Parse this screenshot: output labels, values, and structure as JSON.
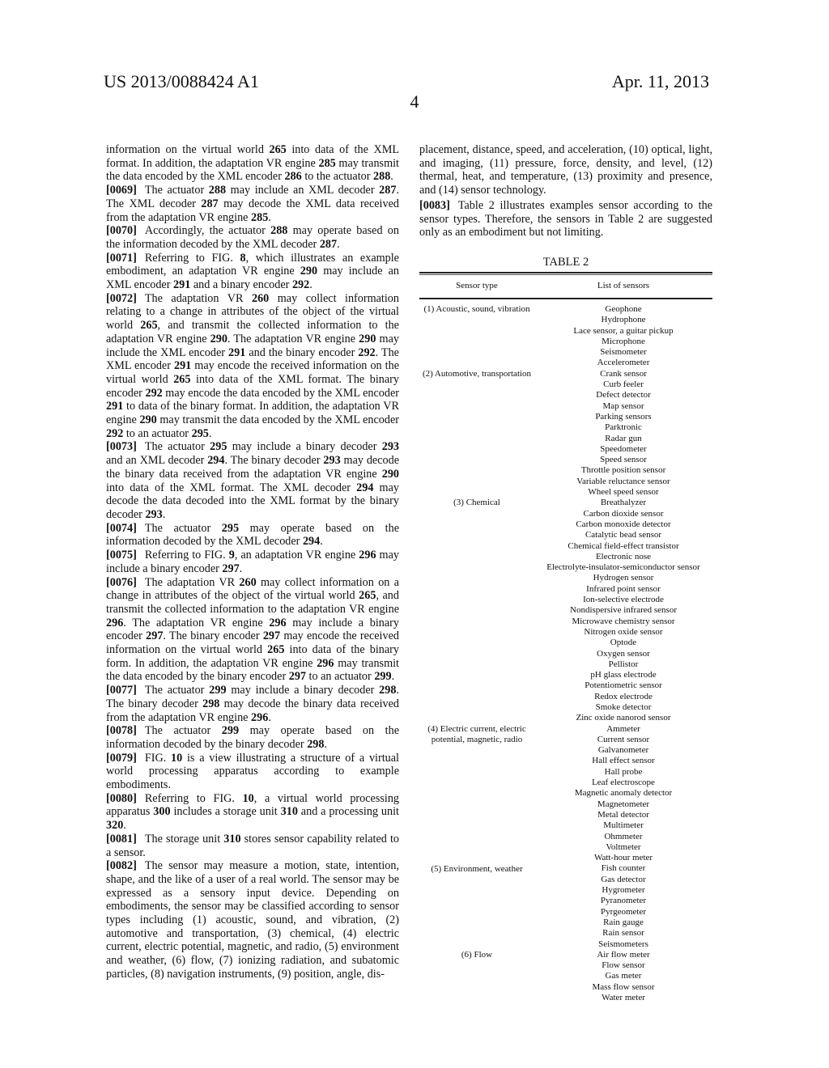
{
  "header": {
    "publication_number": "US 2013/0088424 A1",
    "date": "Apr. 11, 2013",
    "page_number": "4"
  },
  "left_column": [
    {
      "num": "",
      "html": "information on the virtual world <b>265</b> into data of the XML format. In addition, the adaptation VR engine <b>285</b> may transmit the data encoded by the XML encoder <b>286</b> to the actuator <b>288</b>."
    },
    {
      "num": "[0069]",
      "html": "The actuator <b>288</b> may include an XML decoder <b>287</b>. The XML decoder <b>287</b> may decode the XML data received from the adaptation VR engine <b>285</b>."
    },
    {
      "num": "[0070]",
      "html": "Accordingly, the actuator <b>288</b> may operate based on the information decoded by the XML decoder <b>287</b>."
    },
    {
      "num": "[0071]",
      "html": "Referring to FIG. <b>8</b>, which illustrates an example embodiment, an adaptation VR engine <b>290</b> may include an XML encoder <b>291</b> and a binary encoder <b>292</b>."
    },
    {
      "num": "[0072]",
      "html": "The adaptation VR <b>260</b> may collect information relating to a change in attributes of the object of the virtual world <b>265</b>, and transmit the collected information to the adaptation VR engine <b>290</b>. The adaptation VR engine <b>290</b> may include the XML encoder <b>291</b> and the binary encoder <b>292</b>. The XML encoder <b>291</b> may encode the received information on the virtual world <b>265</b> into data of the XML format. The binary encoder <b>292</b> may encode the data encoded by the XML encoder <b>291</b> to data of the binary format. In addition, the adaptation VR engine <b>290</b> may transmit the data encoded by the XML encoder <b>292</b> to an actuator <b>295</b>."
    },
    {
      "num": "[0073]",
      "html": "The actuator <b>295</b> may include a binary decoder <b>293</b> and an XML decoder <b>294</b>. The binary decoder <b>293</b> may decode the binary data received from the adaptation VR engine <b>290</b> into data of the XML format. The XML decoder <b>294</b> may decode the data decoded into the XML format by the binary decoder <b>293</b>."
    },
    {
      "num": "[0074]",
      "html": "The actuator <b>295</b> may operate based on the information decoded by the XML decoder <b>294</b>."
    },
    {
      "num": "[0075]",
      "html": "Referring to FIG. <b>9</b>, an adaptation VR engine <b>296</b> may include a binary encoder <b>297</b>."
    },
    {
      "num": "[0076]",
      "html": "The adaptation VR <b>260</b> may collect information on a change in attributes of the object of the virtual world <b>265</b>, and transmit the collected information to the adaptation VR engine <b>296</b>. The adaptation VR engine <b>296</b> may include a binary encoder <b>297</b>. The binary encoder <b>297</b> may encode the received information on the virtual world <b>265</b> into data of the binary form. In addition, the adaptation VR engine <b>296</b> may transmit the data encoded by the binary encoder <b>297</b> to an actuator <b>299</b>."
    },
    {
      "num": "[0077]",
      "html": "The actuator <b>299</b> may include a binary decoder <b>298</b>. The binary decoder <b>298</b> may decode the binary data received from the adaptation VR engine <b>296</b>."
    },
    {
      "num": "[0078]",
      "html": "The actuator <b>299</b> may operate based on the information decoded by the binary decoder <b>298</b>."
    },
    {
      "num": "[0079]",
      "html": "FIG. <b>10</b> is a view illustrating a structure of a virtual world processing apparatus according to example embodiments."
    },
    {
      "num": "[0080]",
      "html": "Referring to FIG. <b>10</b>, a virtual world processing apparatus <b>300</b> includes a storage unit <b>310</b> and a processing unit <b>320</b>."
    },
    {
      "num": "[0081]",
      "html": "The storage unit <b>310</b> stores sensor capability related to a sensor."
    },
    {
      "num": "[0082]",
      "html": "The sensor may measure a motion, state, intention, shape, and the like of a user of a real world. The sensor may be expressed as a sensory input device. Depending on embodiments, the sensor may be classified according to sensor types including (1) acoustic, sound, and vibration, (2) automotive and transportation, (3) chemical, (4) electric current, electric potential, magnetic, and radio, (5) environment and weather, (6) flow, (7) ionizing radiation, and subatomic particles, (8) navigation instruments, (9) position, angle, dis-"
    }
  ],
  "right_column": [
    {
      "num": "",
      "html": "placement, distance, speed, and acceleration, (10) optical, light, and imaging, (11) pressure, force, density, and level, (12) thermal, heat, and temperature, (13) proximity and presence, and (14) sensor technology."
    },
    {
      "num": "[0083]",
      "html": "Table 2 illustrates examples sensor according to the sensor types. Therefore, the sensors in Table 2 are suggested only as an embodiment but not limiting."
    }
  ],
  "table": {
    "title": "TABLE 2",
    "headers": [
      "Sensor type",
      "List of sensors"
    ],
    "groups": [
      {
        "type": "(1) Acoustic, sound, vibration",
        "sensors": [
          "Geophone",
          "Hydrophone",
          "Lace sensor, a guitar pickup",
          "Microphone",
          "Seismometer",
          "Accelerometer"
        ]
      },
      {
        "type": "(2) Automotive, transportation",
        "sensors": [
          "Crank sensor",
          "Curb feeler",
          "Defect detector",
          "Map sensor",
          "Parking sensors",
          "Parktronic",
          "Radar gun",
          "Speedometer",
          "Speed sensor",
          "Throttle position sensor",
          "Variable reluctance sensor",
          "Wheel speed sensor"
        ]
      },
      {
        "type": "(3) Chemical",
        "sensors": [
          "Breathalyzer",
          "Carbon dioxide sensor",
          "Carbon monoxide detector",
          "Catalytic bead sensor",
          "Chemical field-effect transistor",
          "Electronic nose",
          "Electrolyte-insulator-semiconductor sensor",
          "Hydrogen sensor",
          "Infrared point sensor",
          "Ion-selective electrode",
          "Nondispersive infrared sensor",
          "Microwave chemistry sensor",
          "Nitrogen oxide sensor",
          "Optode",
          "Oxygen sensor",
          "Pellistor",
          "pH glass electrode",
          "Potentiometric sensor",
          "Redox electrode",
          "Smoke detector",
          "Zinc oxide nanorod sensor"
        ]
      },
      {
        "type": "(4) Electric current, electric potential, magnetic, radio",
        "sensors": [
          "Ammeter",
          "Current sensor",
          "Galvanometer",
          "Hall effect sensor",
          "Hall probe",
          "Leaf electroscope",
          "Magnetic anomaly detector",
          "Magnetometer",
          "Metal detector",
          "Multimeter",
          "Ohmmeter",
          "Voltmeter",
          "Watt-hour meter"
        ]
      },
      {
        "type": "(5) Environment, weather",
        "sensors": [
          "Fish counter",
          "Gas detector",
          "Hygrometer",
          "Pyranometer",
          "Pyrgeometer",
          "Rain gauge",
          "Rain sensor",
          "Seismometers"
        ]
      },
      {
        "type": "(6) Flow",
        "sensors": [
          "Air flow meter",
          "Flow sensor",
          "Gas meter",
          "Mass flow sensor",
          "Water meter"
        ]
      }
    ]
  }
}
